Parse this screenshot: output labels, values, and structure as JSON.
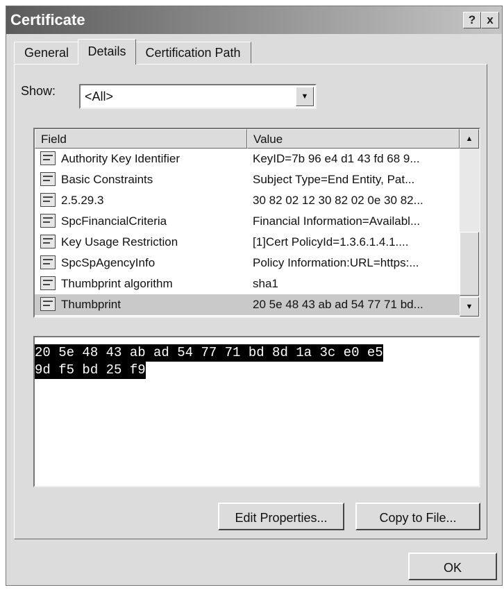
{
  "window": {
    "title": "Certificate",
    "help_label": "?",
    "close_label": "x"
  },
  "tabs": [
    {
      "label": "General",
      "active": false
    },
    {
      "label": "Details",
      "active": true
    },
    {
      "label": "Certification Path",
      "active": false
    }
  ],
  "show": {
    "label": "Show:",
    "value": "<All>"
  },
  "list": {
    "headers": {
      "field": "Field",
      "value": "Value"
    },
    "rows": [
      {
        "field": "Authority Key Identifier",
        "value": "KeyID=7b 96 e4 d1 43 fd 68 9..."
      },
      {
        "field": "Basic Constraints",
        "value": "Subject Type=End Entity, Pat..."
      },
      {
        "field": "2.5.29.3",
        "value": "30 82 02 12 30 82 02 0e 30 82..."
      },
      {
        "field": "SpcFinancialCriteria",
        "value": "Financial Information=Availabl..."
      },
      {
        "field": "Key Usage Restriction",
        "value": "[1]Cert PolicyId=1.3.6.1.4.1...."
      },
      {
        "field": "SpcSpAgencyInfo",
        "value": "Policy Information:URL=https:..."
      },
      {
        "field": "Thumbprint algorithm",
        "value": "sha1"
      },
      {
        "field": "Thumbprint",
        "value": "20 5e 48 43 ab ad 54 77 71 bd..."
      }
    ]
  },
  "detail": {
    "line1": "20 5e 48 43 ab ad 54 77 71 bd 8d 1a 3c e0 e5",
    "line2": "9d f5 bd 25 f9"
  },
  "buttons": {
    "edit_properties": "Edit Properties...",
    "copy_to_file": "Copy to File...",
    "ok": "OK"
  }
}
